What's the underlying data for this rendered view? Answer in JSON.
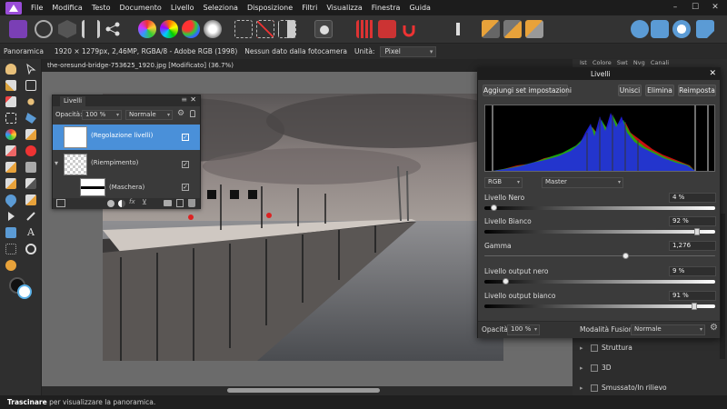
{
  "menubar": {
    "items": [
      "File",
      "Modifica",
      "Testo",
      "Documento",
      "Livello",
      "Seleziona",
      "Disposizione",
      "Filtri",
      "Visualizza",
      "Finestra",
      "Guida"
    ],
    "window_controls": [
      "–",
      "☐",
      "✕"
    ]
  },
  "context": {
    "persona": "Panoramica",
    "doc_info": "1920 × 1279px, 2,46MP, RGBA/8 - Adobe RGB (1998)",
    "camera": "Nessun dato dalla fotocamera",
    "units_label": "Unità:",
    "units_value": "Pixel"
  },
  "document": {
    "tab_title": "the-oresund-bridge-753625_1920.jpg [Modificato] (36.7%)"
  },
  "layers_panel": {
    "title": "Livelli",
    "opacity_label": "Opacità:",
    "opacity_value": "100 %",
    "blend_value": "Normale",
    "layers": [
      {
        "name": "(Regolazione livelli)",
        "checked": true,
        "selected": true
      },
      {
        "name": "(Riempimento)",
        "checked": true,
        "selected": false
      },
      {
        "name": "(Maschera)",
        "checked": true,
        "selected": false
      }
    ]
  },
  "levels_dialog": {
    "title": "Livelli",
    "add_preset": "Aggiungi set impostazioni",
    "merge": "Unisci",
    "delete": "Elimina",
    "reset": "Reimposta",
    "channel": "RGB",
    "preset": "Master",
    "sliders": [
      {
        "label": "Livello Nero",
        "value": "4 %",
        "pos": 0.04
      },
      {
        "label": "Livello Bianco",
        "value": "92 %",
        "pos": 0.92
      },
      {
        "label": "Gamma",
        "value": "1,276",
        "pos": 0.61
      },
      {
        "label": "Livello output nero",
        "value": "9 %",
        "pos": 0.09
      },
      {
        "label": "Livello output bianco",
        "value": "91 %",
        "pos": 0.91
      }
    ],
    "opacity_label": "Opacità:",
    "opacity_value": "100 %",
    "blend_label": "Modalità Fusione:",
    "blend_value": "Normale"
  },
  "right_panel": {
    "tabs": [
      "Ist",
      "Colore",
      "Swt",
      "Nvg",
      "Canali"
    ],
    "effects": [
      "Struttura",
      "3D",
      "Smussato/In rilievo"
    ]
  },
  "status": {
    "bold": "Trascinare",
    "text": " per visualizzare la panoramica."
  },
  "colors": {
    "accent": "#4a90d9",
    "menubar": "#1c1c1c",
    "panel": "#3b3b3b"
  }
}
